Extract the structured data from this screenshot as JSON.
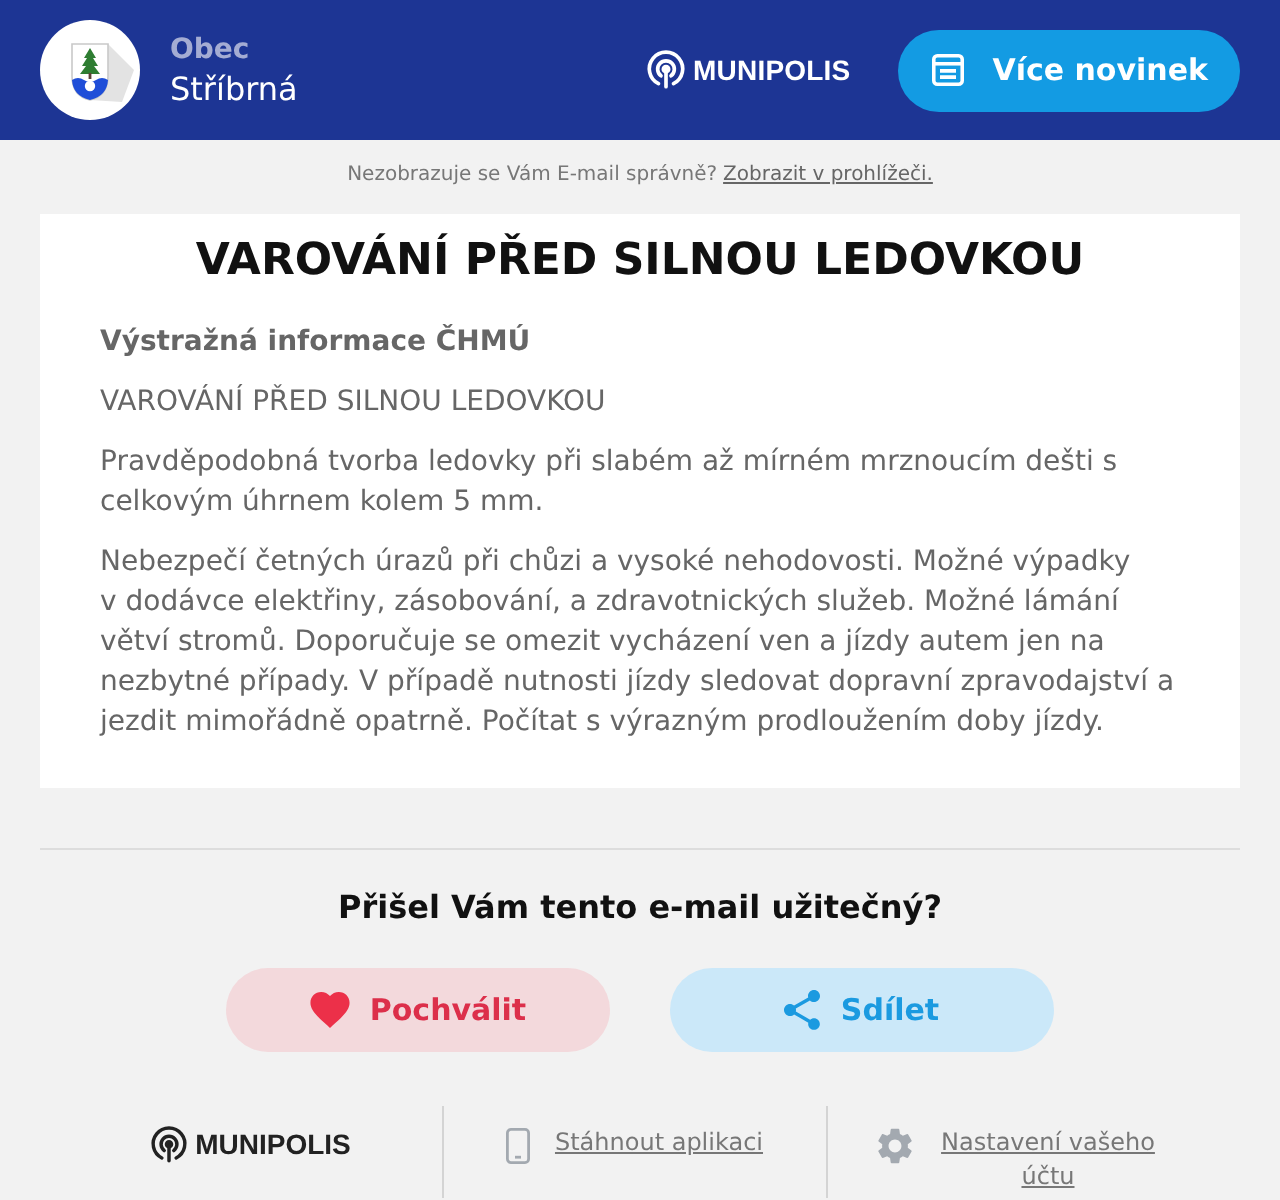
{
  "header": {
    "municipality_label": "Obec",
    "municipality_name": "Stříbrná",
    "brand": "MUNIPOLIS",
    "more_news_button": "Více novinek"
  },
  "notice": {
    "text": "Nezobrazuje se Vám E-mail správně?",
    "link": "Zobrazit v prohlížeči."
  },
  "article": {
    "title": "VAROVÁNÍ PŘED SILNOU LEDOVKOU",
    "source": "Výstražná informace ČHMÚ",
    "paragraphs": [
      "VAROVÁNÍ PŘED SILNOU LEDOVKOU",
      "Pravděpodobná tvorba ledovky při slabém až mírném mrznoucím dešti s celkovým úhrnem kolem 5 mm.",
      "Nebezpečí četných úrazů při chůzi a vysoké nehodovosti. Možné výpadky v dodávce elektřiny, zásobování, a zdravotnických služeb. Možné lámání větví stromů. Doporučuje se omezit vycházení ven a jízdy autem jen na nezbytné případy. V případě nutnosti jízdy sledovat dopravní zpravodajství a jezdit mimořádně opatrně. Počítat s výrazným prodloužením doby jízdy."
    ]
  },
  "feedback": {
    "question": "Přišel Vám tento e-mail užitečný?",
    "buttons": [
      {
        "kind": "like",
        "label": "Pochválit"
      },
      {
        "kind": "share",
        "label": "Sdílet"
      }
    ]
  },
  "footer": {
    "brand": "MUNIPOLIS",
    "links": [
      {
        "kind": "app",
        "label": "Stáhnout aplikaci"
      },
      {
        "kind": "settings",
        "label": "Nastavení vašeho účtu"
      }
    ]
  }
}
